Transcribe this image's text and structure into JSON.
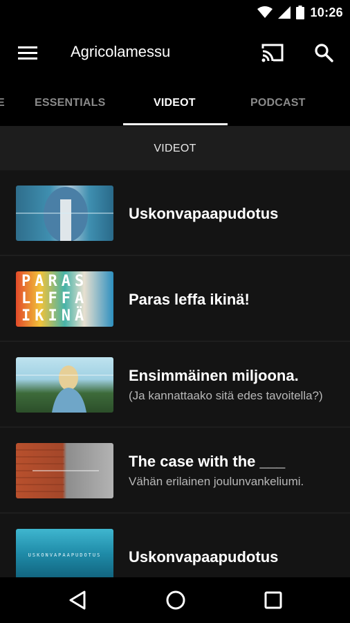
{
  "status_bar": {
    "time": "10:26",
    "icons": [
      "wifi-icon",
      "signal-icon",
      "battery-icon"
    ]
  },
  "app_bar": {
    "title": "Agricolamessu",
    "icons": [
      "menu-icon",
      "cast-icon",
      "search-icon"
    ]
  },
  "tabs": [
    {
      "label": "E",
      "active": false
    },
    {
      "label": "ESSENTIALS",
      "active": false
    },
    {
      "label": "VIDEOT",
      "active": true
    },
    {
      "label": "PODCAST",
      "active": false
    }
  ],
  "section": {
    "title": "VIDEOT"
  },
  "videos": [
    {
      "title": "Uskonvapaapudotus",
      "subtitle": ""
    },
    {
      "title": "Paras leffa ikinä!",
      "subtitle": "",
      "thumb_text": [
        "PARAS",
        "LEFFA",
        "IKINÄ"
      ]
    },
    {
      "title": "Ensimmäinen miljoona.",
      "subtitle": "(Ja kannattaako sitä edes tavoitella?)"
    },
    {
      "title": "The case with the ___",
      "subtitle": "Vähän erilainen joulunvankeliumi."
    },
    {
      "title": "Uskonvapaapudotus",
      "subtitle": "",
      "thumb_text": [
        "USKONVAPAAPUDOTUS"
      ]
    }
  ],
  "nav_bar": {
    "icons": [
      "back-icon",
      "home-icon",
      "recent-apps-icon"
    ]
  },
  "colors": {
    "background": "#141414",
    "bar": "#000000",
    "section_header": "#1d1d1d"
  }
}
